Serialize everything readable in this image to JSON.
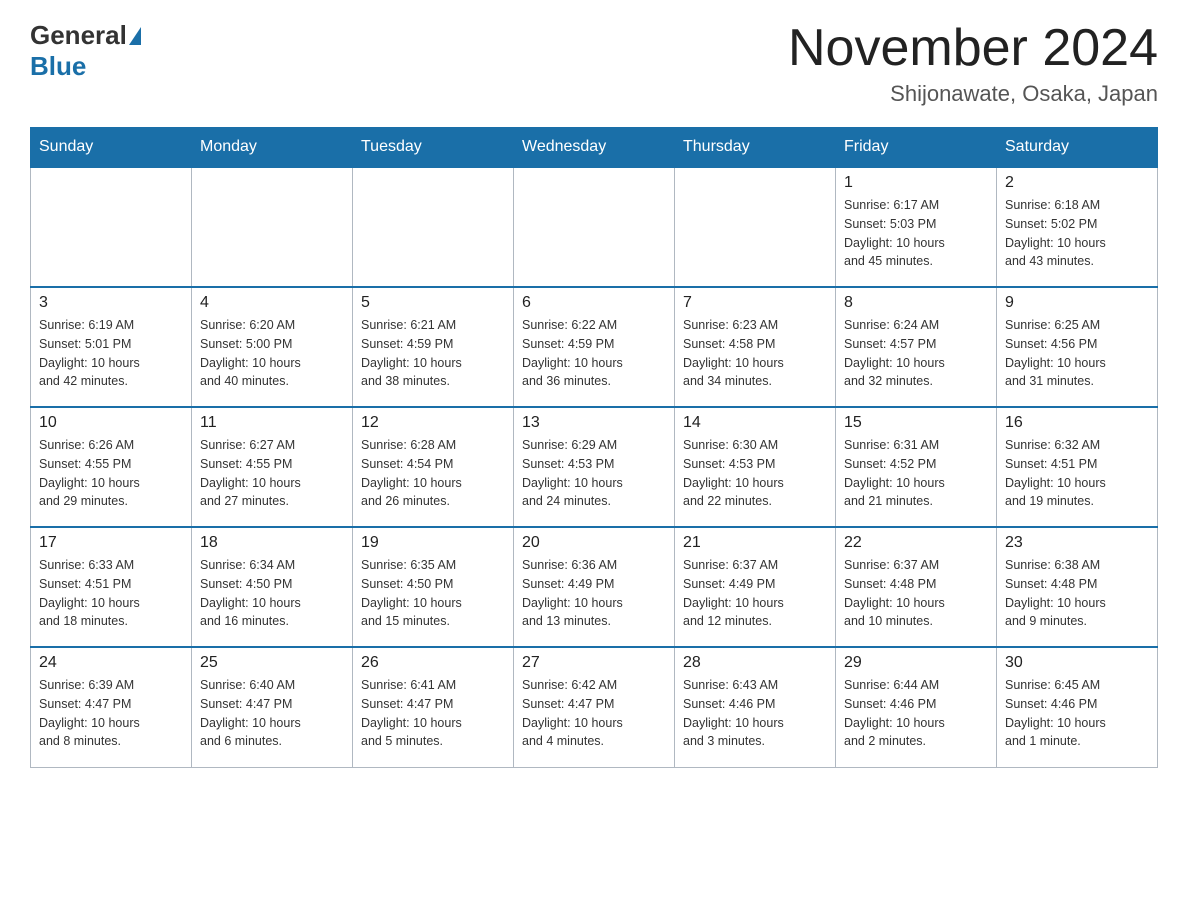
{
  "header": {
    "logo_general": "General",
    "logo_blue": "Blue",
    "month": "November 2024",
    "location": "Shijonawate, Osaka, Japan"
  },
  "days_of_week": [
    "Sunday",
    "Monday",
    "Tuesday",
    "Wednesday",
    "Thursday",
    "Friday",
    "Saturday"
  ],
  "weeks": [
    [
      {
        "day": "",
        "info": ""
      },
      {
        "day": "",
        "info": ""
      },
      {
        "day": "",
        "info": ""
      },
      {
        "day": "",
        "info": ""
      },
      {
        "day": "",
        "info": ""
      },
      {
        "day": "1",
        "info": "Sunrise: 6:17 AM\nSunset: 5:03 PM\nDaylight: 10 hours\nand 45 minutes."
      },
      {
        "day": "2",
        "info": "Sunrise: 6:18 AM\nSunset: 5:02 PM\nDaylight: 10 hours\nand 43 minutes."
      }
    ],
    [
      {
        "day": "3",
        "info": "Sunrise: 6:19 AM\nSunset: 5:01 PM\nDaylight: 10 hours\nand 42 minutes."
      },
      {
        "day": "4",
        "info": "Sunrise: 6:20 AM\nSunset: 5:00 PM\nDaylight: 10 hours\nand 40 minutes."
      },
      {
        "day": "5",
        "info": "Sunrise: 6:21 AM\nSunset: 4:59 PM\nDaylight: 10 hours\nand 38 minutes."
      },
      {
        "day": "6",
        "info": "Sunrise: 6:22 AM\nSunset: 4:59 PM\nDaylight: 10 hours\nand 36 minutes."
      },
      {
        "day": "7",
        "info": "Sunrise: 6:23 AM\nSunset: 4:58 PM\nDaylight: 10 hours\nand 34 minutes."
      },
      {
        "day": "8",
        "info": "Sunrise: 6:24 AM\nSunset: 4:57 PM\nDaylight: 10 hours\nand 32 minutes."
      },
      {
        "day": "9",
        "info": "Sunrise: 6:25 AM\nSunset: 4:56 PM\nDaylight: 10 hours\nand 31 minutes."
      }
    ],
    [
      {
        "day": "10",
        "info": "Sunrise: 6:26 AM\nSunset: 4:55 PM\nDaylight: 10 hours\nand 29 minutes."
      },
      {
        "day": "11",
        "info": "Sunrise: 6:27 AM\nSunset: 4:55 PM\nDaylight: 10 hours\nand 27 minutes."
      },
      {
        "day": "12",
        "info": "Sunrise: 6:28 AM\nSunset: 4:54 PM\nDaylight: 10 hours\nand 26 minutes."
      },
      {
        "day": "13",
        "info": "Sunrise: 6:29 AM\nSunset: 4:53 PM\nDaylight: 10 hours\nand 24 minutes."
      },
      {
        "day": "14",
        "info": "Sunrise: 6:30 AM\nSunset: 4:53 PM\nDaylight: 10 hours\nand 22 minutes."
      },
      {
        "day": "15",
        "info": "Sunrise: 6:31 AM\nSunset: 4:52 PM\nDaylight: 10 hours\nand 21 minutes."
      },
      {
        "day": "16",
        "info": "Sunrise: 6:32 AM\nSunset: 4:51 PM\nDaylight: 10 hours\nand 19 minutes."
      }
    ],
    [
      {
        "day": "17",
        "info": "Sunrise: 6:33 AM\nSunset: 4:51 PM\nDaylight: 10 hours\nand 18 minutes."
      },
      {
        "day": "18",
        "info": "Sunrise: 6:34 AM\nSunset: 4:50 PM\nDaylight: 10 hours\nand 16 minutes."
      },
      {
        "day": "19",
        "info": "Sunrise: 6:35 AM\nSunset: 4:50 PM\nDaylight: 10 hours\nand 15 minutes."
      },
      {
        "day": "20",
        "info": "Sunrise: 6:36 AM\nSunset: 4:49 PM\nDaylight: 10 hours\nand 13 minutes."
      },
      {
        "day": "21",
        "info": "Sunrise: 6:37 AM\nSunset: 4:49 PM\nDaylight: 10 hours\nand 12 minutes."
      },
      {
        "day": "22",
        "info": "Sunrise: 6:37 AM\nSunset: 4:48 PM\nDaylight: 10 hours\nand 10 minutes."
      },
      {
        "day": "23",
        "info": "Sunrise: 6:38 AM\nSunset: 4:48 PM\nDaylight: 10 hours\nand 9 minutes."
      }
    ],
    [
      {
        "day": "24",
        "info": "Sunrise: 6:39 AM\nSunset: 4:47 PM\nDaylight: 10 hours\nand 8 minutes."
      },
      {
        "day": "25",
        "info": "Sunrise: 6:40 AM\nSunset: 4:47 PM\nDaylight: 10 hours\nand 6 minutes."
      },
      {
        "day": "26",
        "info": "Sunrise: 6:41 AM\nSunset: 4:47 PM\nDaylight: 10 hours\nand 5 minutes."
      },
      {
        "day": "27",
        "info": "Sunrise: 6:42 AM\nSunset: 4:47 PM\nDaylight: 10 hours\nand 4 minutes."
      },
      {
        "day": "28",
        "info": "Sunrise: 6:43 AM\nSunset: 4:46 PM\nDaylight: 10 hours\nand 3 minutes."
      },
      {
        "day": "29",
        "info": "Sunrise: 6:44 AM\nSunset: 4:46 PM\nDaylight: 10 hours\nand 2 minutes."
      },
      {
        "day": "30",
        "info": "Sunrise: 6:45 AM\nSunset: 4:46 PM\nDaylight: 10 hours\nand 1 minute."
      }
    ]
  ]
}
